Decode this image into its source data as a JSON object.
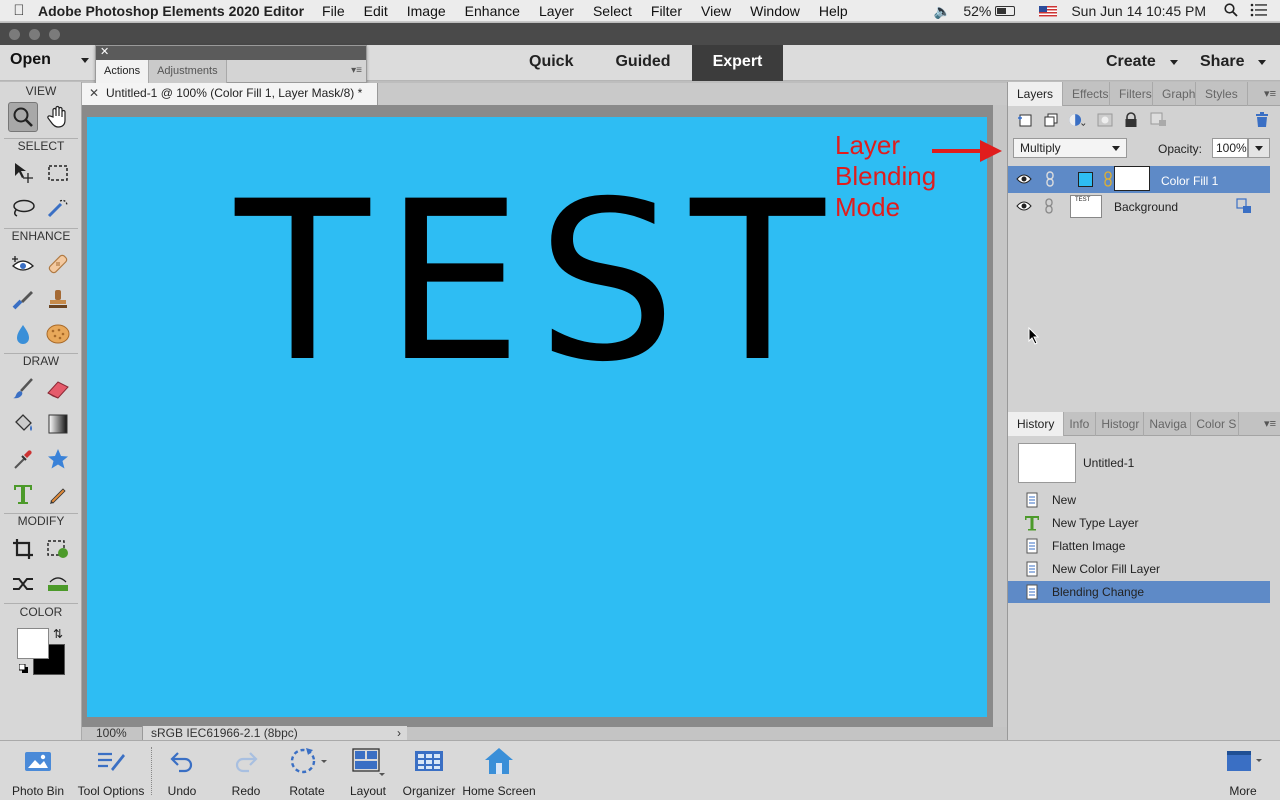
{
  "menubar": {
    "app_name": "Adobe Photoshop Elements 2020 Editor",
    "items": [
      "File",
      "Edit",
      "Image",
      "Enhance",
      "Layer",
      "Select",
      "Filter",
      "View",
      "Window",
      "Help"
    ],
    "battery": "52%",
    "datetime": "Sun Jun 14  10:45 PM"
  },
  "topbar": {
    "open_label": "Open",
    "modes": [
      {
        "label": "Quick",
        "active": false
      },
      {
        "label": "Guided",
        "active": false
      },
      {
        "label": "Expert",
        "active": true
      }
    ],
    "create_label": "Create",
    "share_label": "Share"
  },
  "float_panel": {
    "tabs": [
      "Actions",
      "Adjustments"
    ]
  },
  "toolbox": {
    "sections": [
      "VIEW",
      "SELECT",
      "ENHANCE",
      "DRAW",
      "MODIFY",
      "COLOR"
    ]
  },
  "document": {
    "tab_title": "Untitled-1 @ 100% (Color Fill 1, Layer Mask/8) *",
    "canvas_text": "TEST",
    "canvas_color": "#2ebdf3",
    "zoom": "100%",
    "color_profile": "sRGB IEC61966-2.1 (8bpc)"
  },
  "annotation": {
    "lines": [
      "Layer",
      "Blending",
      "Mode"
    ],
    "color": "#e01d1d"
  },
  "layers_panel": {
    "tabs": [
      "Layers",
      "Effects",
      "Filters",
      "Graphi",
      "Styles"
    ],
    "blend_mode": "Multiply",
    "opacity_label": "Opacity:",
    "opacity_value": "100%",
    "layers": [
      {
        "name": "Color Fill 1",
        "selected": true
      },
      {
        "name": "Background",
        "selected": false,
        "thumb_text": "TEST"
      }
    ]
  },
  "history_panel": {
    "tabs": [
      "History",
      "Info",
      "Histogr",
      "Naviga",
      "Color S"
    ],
    "snapshot": "Untitled-1",
    "items": [
      {
        "label": "New",
        "icon": "document-icon",
        "selected": false
      },
      {
        "label": "New Type Layer",
        "icon": "type-icon",
        "selected": false
      },
      {
        "label": "Flatten Image",
        "icon": "document-icon",
        "selected": false
      },
      {
        "label": "New Color Fill Layer",
        "icon": "document-icon",
        "selected": false
      },
      {
        "label": "Blending Change",
        "icon": "document-icon",
        "selected": true
      }
    ]
  },
  "bottombar": {
    "items": [
      "Photo Bin",
      "Tool Options",
      "Undo",
      "Redo",
      "Rotate",
      "Layout",
      "Organizer",
      "Home Screen"
    ],
    "more_label": "More"
  },
  "colors": {
    "accent_selected": "#5e8ac7",
    "mode_active_bg": "#3c3c3c"
  }
}
